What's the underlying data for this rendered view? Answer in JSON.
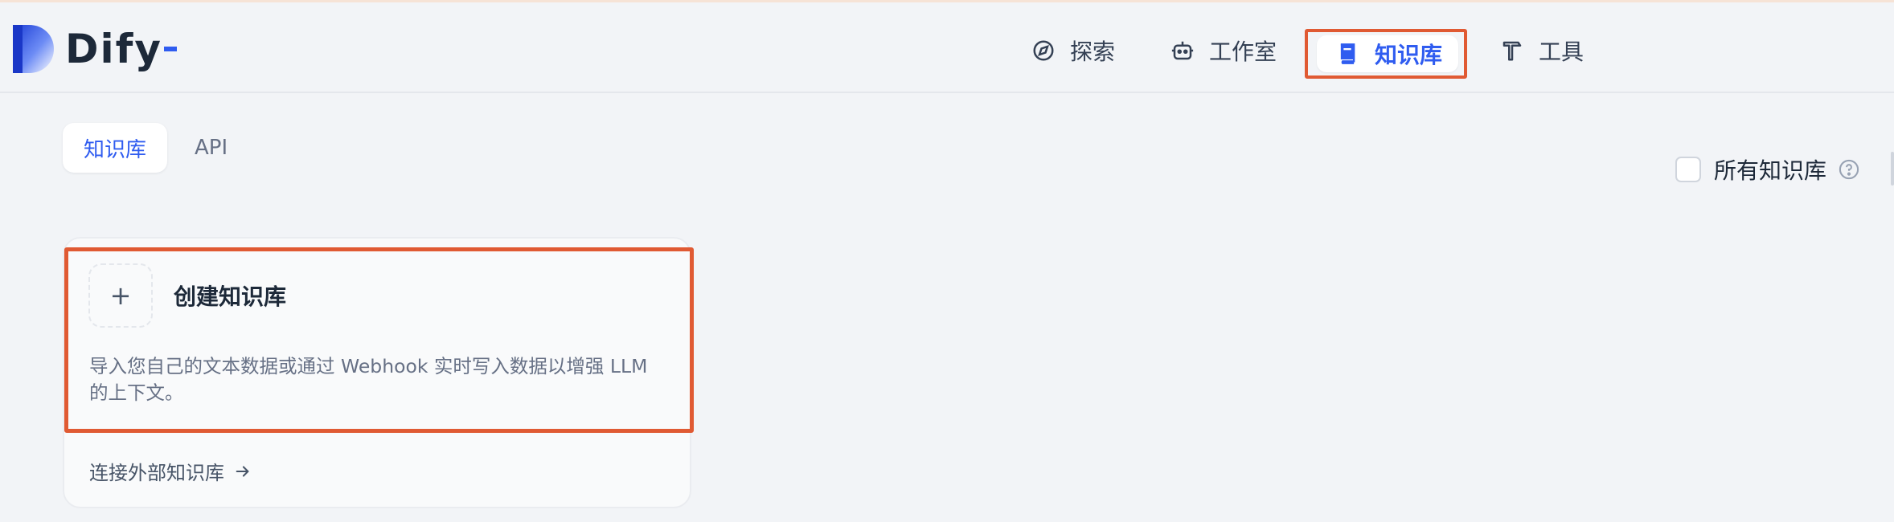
{
  "app": {
    "logo_text": "Dify"
  },
  "nav": {
    "explore": "探索",
    "studio": "工作室",
    "knowledge": "知识库",
    "tools": "工具"
  },
  "tabs": [
    {
      "label": "知识库",
      "active": true
    },
    {
      "label": "API",
      "active": false
    }
  ],
  "filter": {
    "all_knowledge_label": "所有知识库",
    "checked": false
  },
  "create_card": {
    "plus": "+",
    "title": "创建知识库",
    "description_line1": "导入您自己的文本数据或通过 Webhook 实时写入数据以增强 LLM",
    "description_line2": "的上下文。",
    "external_link": "连接外部知识库"
  },
  "colors": {
    "accent": "#2f5cf0",
    "highlight_frame": "#e05a33",
    "background": "#f2f4f7"
  }
}
